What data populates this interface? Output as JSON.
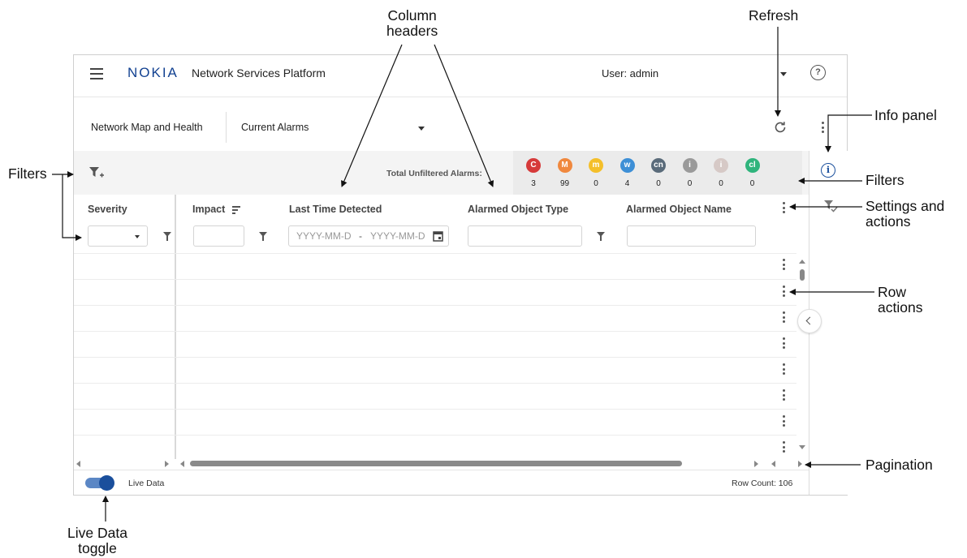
{
  "app": {
    "logo": "NOKIA",
    "title": "Network Services Platform",
    "user_label": "User: admin"
  },
  "nav": {
    "section": "Network Map and Health",
    "view_selector": "Current Alarms"
  },
  "filters": {
    "total_label": "Total Unfiltered Alarms:",
    "severity_badges": [
      {
        "code": "C",
        "count": "3",
        "color": "#d63a3a"
      },
      {
        "code": "M",
        "count": "99",
        "color": "#f0883e"
      },
      {
        "code": "m",
        "count": "0",
        "color": "#f4bf2a"
      },
      {
        "code": "w",
        "count": "4",
        "color": "#3d8fd6"
      },
      {
        "code": "cn",
        "count": "0",
        "color": "#5a6b7a"
      },
      {
        "code": "i",
        "count": "0",
        "color": "#9a9a9a"
      },
      {
        "code": "i",
        "count": "0",
        "color": "#d6c9c6"
      },
      {
        "code": "cl",
        "count": "0",
        "color": "#2fb47c"
      }
    ]
  },
  "table": {
    "columns": [
      "Severity",
      "Impact",
      "Last Time Detected",
      "Alarmed Object Type",
      "Alarmed Object Name"
    ],
    "date_from_placeholder": "YYYY-MM-D",
    "date_separator": "-",
    "date_to_placeholder": "YYYY-MM-D"
  },
  "footer": {
    "live_data_label": "Live Data",
    "live_data_on": true,
    "row_count": "Row Count: 106"
  },
  "callouts": {
    "column_headers": "Column\nheaders",
    "refresh": "Refresh",
    "info_panel": "Info panel",
    "filters_left": "Filters",
    "filters_right": "Filters",
    "settings_actions": "Settings and\nactions",
    "row_actions": "Row\nactions",
    "pagination": "Pagination",
    "live_toggle": "Live Data\ntoggle"
  }
}
